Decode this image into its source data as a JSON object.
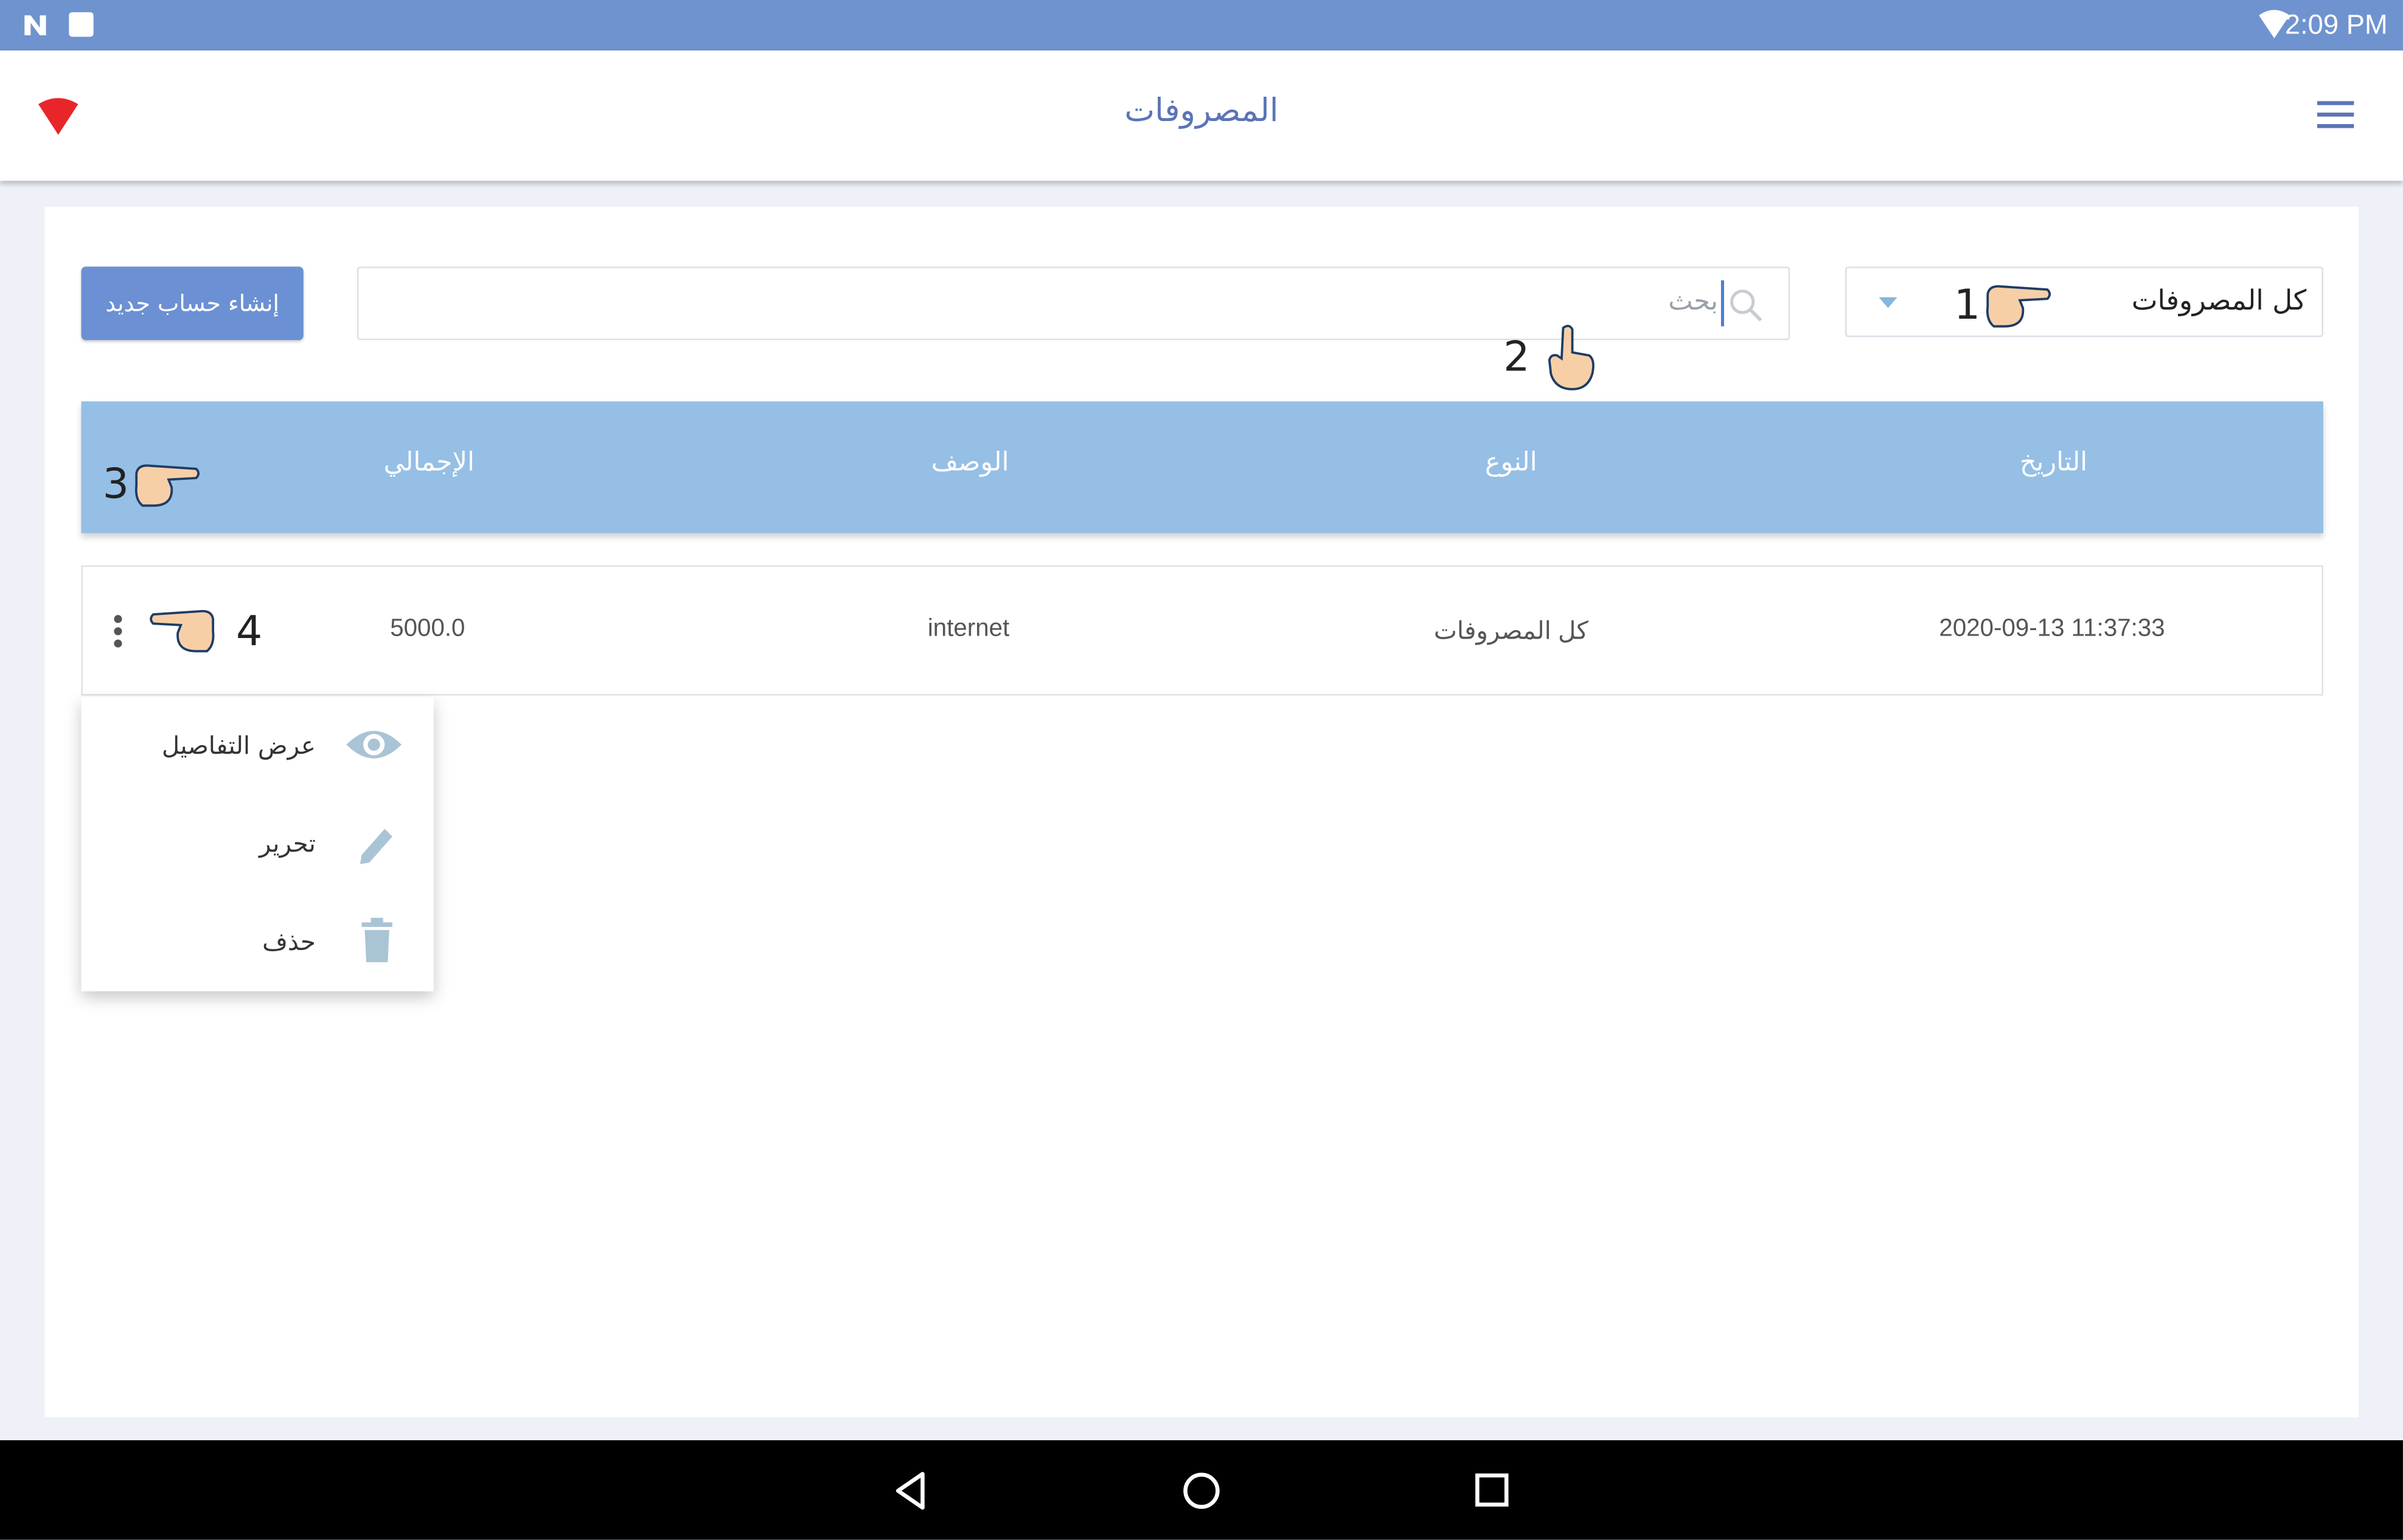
{
  "status_bar": {
    "time": "2:09 PM"
  },
  "app_bar": {
    "title": "المصروفات"
  },
  "toolbar": {
    "create_button_label": "إنشاء حساب جديد",
    "search_placeholder": "بحث",
    "filter_value": "كل المصروفات"
  },
  "table": {
    "columns": [
      "التاريخ",
      "النوع",
      "الوصف",
      "الإجمالي"
    ],
    "rows": [
      {
        "date": "2020-09-13 11:37:33",
        "type": "كل المصروفات",
        "description": "internet",
        "total": "5000.0"
      }
    ]
  },
  "row_menu": {
    "items": [
      {
        "label": "عرض التفاصيل",
        "icon": "eye-icon"
      },
      {
        "label": "تحرير",
        "icon": "pencil-icon"
      },
      {
        "label": "حذف",
        "icon": "trash-icon"
      }
    ]
  },
  "annotations": [
    "1",
    "2",
    "3",
    "4"
  ],
  "colors": {
    "status_bar": "#6f93cf",
    "primary_button": "#6c90d4",
    "table_header": "#95bfe5",
    "title_text": "#5b74b8",
    "menu_icon": "#a9c4d4"
  }
}
